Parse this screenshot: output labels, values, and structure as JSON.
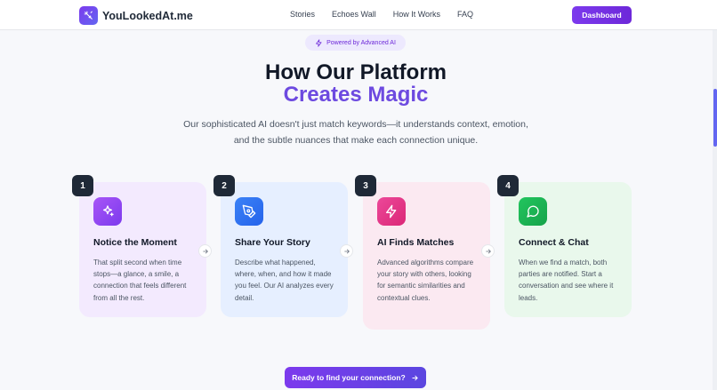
{
  "header": {
    "logo_text": "YouLookedAt.me",
    "nav": [
      {
        "label": "Stories"
      },
      {
        "label": "Echoes Wall"
      },
      {
        "label": "How It Works"
      },
      {
        "label": "FAQ"
      }
    ],
    "dashboard_label": "Dashboard"
  },
  "hero": {
    "badge": "Powered by Advanced AI",
    "title_line1": "How Our Platform",
    "title_line2": "Creates Magic",
    "subtitle": "Our sophisticated AI doesn't just match keywords—it understands context, emotion, and the subtle nuances that make each connection unique."
  },
  "steps": [
    {
      "num": "1",
      "title": "Notice the Moment",
      "desc": "That split second when time stops—a glance, a smile, a connection that feels different from all the rest.",
      "icon": "sparkles-icon"
    },
    {
      "num": "2",
      "title": "Share Your Story",
      "desc": "Describe what happened, where, when, and how it made you feel. Our AI analyzes every detail.",
      "icon": "pen-tool-icon"
    },
    {
      "num": "3",
      "title": "AI Finds Matches",
      "desc": "Advanced algorithms compare your story with others, looking for semantic similarities and contextual clues.",
      "icon": "lightning-icon"
    },
    {
      "num": "4",
      "title": "Connect & Chat",
      "desc": "When we find a match, both parties are notified. Start a conversation and see where it leads.",
      "icon": "chat-bubble-icon"
    }
  ],
  "cta_label": "Ready to find your connection?",
  "colors": {
    "accent": "#6d4ae0",
    "card1_bg": "#f3eafe",
    "card2_bg": "#e6efff",
    "card3_bg": "#fbe9f1",
    "card4_bg": "#e9f8ec"
  }
}
